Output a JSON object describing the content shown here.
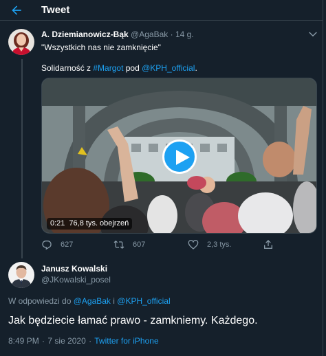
{
  "header": {
    "title": "Tweet"
  },
  "tweet_1": {
    "author_name": "A. Dziemianowicz-Bąk",
    "author_handle": "@AgaBak",
    "separator": "·",
    "age": "14 g.",
    "quote": "\"Wszystkich nas nie zamknięcie\"",
    "text_prefix": "Solidarność z ",
    "hashtag": "#Margot",
    "text_middle": " pod ",
    "mention": "@KPH_official",
    "text_suffix": ".",
    "video": {
      "time": "0:21",
      "views": "76,8 tys. obejrzeń"
    },
    "actions": {
      "replies": "627",
      "retweets": "607",
      "likes": "2,3 tys."
    }
  },
  "tweet_2": {
    "author_name": "Janusz Kowalski",
    "author_handle": "@JKowalski_posel",
    "reply_prefix": "W odpowiedzi do ",
    "reply_mention_1": "@AgaBak",
    "reply_conjunction": " i ",
    "reply_mention_2": "@KPH_official",
    "text": "Jak będziecie łamać prawo - zamkniemy. Każdego.",
    "time": "8:49 PM",
    "separator": "·",
    "date": "7 sie 2020",
    "source": "Twitter for iPhone"
  },
  "colors": {
    "background": "#15202b",
    "accent": "#1da1f2",
    "secondary_text": "#8899a6",
    "divider": "#38444d"
  },
  "icons": [
    "back-arrow-icon",
    "more-chevron-icon",
    "play-icon",
    "reply-icon",
    "retweet-icon",
    "like-icon",
    "share-icon"
  ]
}
